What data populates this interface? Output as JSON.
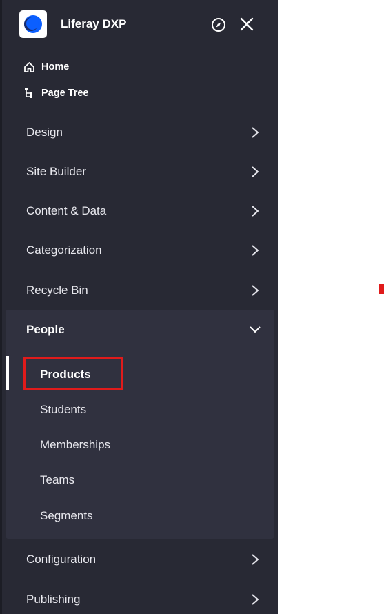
{
  "site": {
    "name": "Liferay DXP"
  },
  "quick_links": [
    {
      "label": "Home",
      "icon": "home-icon"
    },
    {
      "label": "Page Tree",
      "icon": "page-tree-icon"
    }
  ],
  "menu": {
    "design": "Design",
    "site_builder": "Site Builder",
    "content_data": "Content & Data",
    "categorization": "Categorization",
    "recycle_bin": "Recycle Bin",
    "people": "People",
    "configuration": "Configuration",
    "publishing": "Publishing"
  },
  "people_items": [
    "Products",
    "Students",
    "Memberships",
    "Teams",
    "Segments"
  ],
  "active_item": "Products",
  "colors": {
    "panel_bg": "#282934",
    "expanded_bg": "#30313f",
    "highlight": "#e01b1b",
    "text": "#e7e7ed"
  }
}
